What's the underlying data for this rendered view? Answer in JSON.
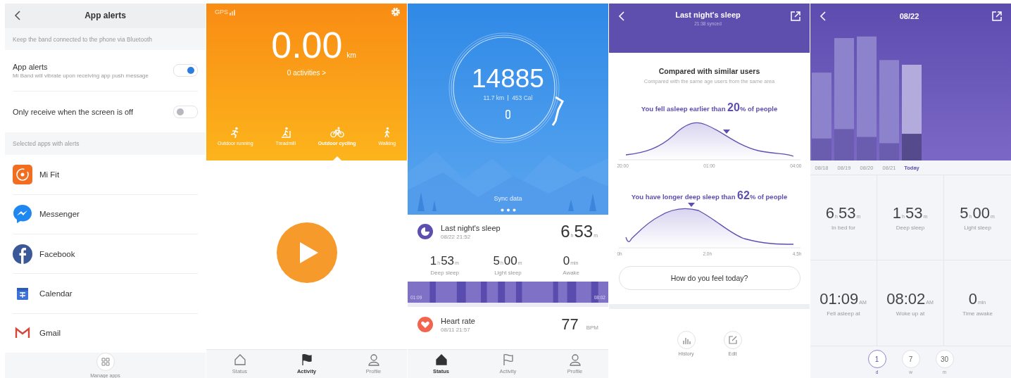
{
  "app_alerts": {
    "title": "App alerts",
    "note": "Keep the band connected to the phone via Bluetooth",
    "toggles": [
      {
        "label": "App alerts",
        "description": "Mi Band will vibrate upon receiving app push message",
        "on": true
      },
      {
        "label": "Only receive when the screen is off",
        "on": false
      }
    ],
    "section": "Selected apps with alerts",
    "apps": [
      {
        "name": "Mi Fit",
        "kind": "mifit"
      },
      {
        "name": "Messenger",
        "kind": "messenger"
      },
      {
        "name": "Facebook",
        "kind": "facebook"
      },
      {
        "name": "Calendar",
        "kind": "calendar"
      },
      {
        "name": "Gmail",
        "kind": "gmail"
      }
    ],
    "manage": "Manage apps"
  },
  "activity": {
    "gps": "GPS",
    "distance": "0.00",
    "unit": "km",
    "activities": "0 activities >",
    "types": [
      {
        "label": "Outdoor running",
        "kind": "run",
        "selected": false
      },
      {
        "label": "Treadmill",
        "kind": "treadmill",
        "selected": false
      },
      {
        "label": "Outdoor cycling",
        "kind": "cycle",
        "selected": true
      },
      {
        "label": "Walking",
        "kind": "walk",
        "selected": false
      }
    ],
    "tabs": [
      {
        "label": "Status",
        "kind": "home",
        "selected": false
      },
      {
        "label": "Activity",
        "kind": "flag",
        "selected": true
      },
      {
        "label": "Profile",
        "kind": "person",
        "selected": false
      }
    ]
  },
  "status": {
    "steps": "14885",
    "distance": "11.7 km",
    "calories": "453 Cal",
    "sync": "Sync data",
    "sleep": {
      "title": "Last night's sleep",
      "time": "08/22 21:52",
      "value": [
        {
          "text": "6",
          "kind": "num"
        },
        {
          "text": "h",
          "kind": "unit"
        },
        {
          "text": "53",
          "kind": "num"
        },
        {
          "text": "m",
          "kind": "unit"
        }
      ]
    },
    "metrics": [
      {
        "label": "Deep sleep",
        "value": [
          {
            "text": "1",
            "kind": "num"
          },
          {
            "text": "h",
            "kind": "unit"
          },
          {
            "text": "53",
            "kind": "num"
          },
          {
            "text": "m",
            "kind": "unit"
          }
        ]
      },
      {
        "label": "Light sleep",
        "value": [
          {
            "text": "5",
            "kind": "num"
          },
          {
            "text": "h",
            "kind": "unit"
          },
          {
            "text": "00",
            "kind": "num"
          },
          {
            "text": "m",
            "kind": "unit"
          }
        ]
      },
      {
        "label": "Awake",
        "value": [
          {
            "text": "0",
            "kind": "num"
          },
          {
            "text": "min",
            "kind": "unit"
          }
        ]
      }
    ],
    "timeline": {
      "start": "01:09",
      "end": "08:02"
    },
    "heart": {
      "title": "Heart rate",
      "time": "08/11 21:57",
      "value": "77",
      "unit": "BPM"
    },
    "tabs": [
      {
        "label": "Status",
        "kind": "home",
        "selected": true
      },
      {
        "label": "Activity",
        "kind": "flag",
        "selected": false
      },
      {
        "label": "Profile",
        "kind": "person",
        "selected": false
      }
    ]
  },
  "sleep_detail": {
    "title": "Last night's sleep",
    "synced": "21:38 synced",
    "heading": "Compared with similar users",
    "subheading": "Compared with the same age users from the same area",
    "comparisons": [
      {
        "text": "You fell asleep earlier than **20**% of people",
        "axis": [
          "20:00",
          "01:00",
          "04:00"
        ],
        "kind": "bedtime"
      },
      {
        "text": "You have longer deep sleep than **62**% of people",
        "axis": [
          "0h",
          "2.0h",
          "4.5h"
        ],
        "kind": "deep"
      }
    ],
    "feel": "How do you feel today?",
    "actions": [
      {
        "label": "History",
        "kind": "chart"
      },
      {
        "label": "Edit",
        "kind": "edit"
      }
    ]
  },
  "day_view": {
    "title": "08/22",
    "days": [
      {
        "label": "08/18",
        "selected": false
      },
      {
        "label": "08/19",
        "selected": false
      },
      {
        "label": "08/20",
        "selected": false
      },
      {
        "label": "08/21",
        "selected": false
      },
      {
        "label": "Today",
        "selected": true
      }
    ],
    "stats": [
      {
        "label": "In bed for",
        "value": [
          {
            "text": "6",
            "kind": "num"
          },
          {
            "text": "h",
            "kind": "unit"
          },
          {
            "text": "53",
            "kind": "num"
          },
          {
            "text": "m",
            "kind": "unit"
          }
        ]
      },
      {
        "label": "Deep sleep",
        "value": [
          {
            "text": "1",
            "kind": "num"
          },
          {
            "text": "h",
            "kind": "unit"
          },
          {
            "text": "53",
            "kind": "num"
          },
          {
            "text": "m",
            "kind": "unit"
          }
        ]
      },
      {
        "label": "Light sleep",
        "value": [
          {
            "text": "5",
            "kind": "num"
          },
          {
            "text": "h",
            "kind": "unit"
          },
          {
            "text": "00",
            "kind": "num"
          },
          {
            "text": "m",
            "kind": "unit"
          }
        ]
      },
      {
        "label": "Fell asleep at",
        "value": [
          {
            "text": "01:09",
            "kind": "num"
          },
          {
            "text": "AM",
            "kind": "unit"
          }
        ]
      },
      {
        "label": "Woke up at",
        "value": [
          {
            "text": "08:02",
            "kind": "num"
          },
          {
            "text": "AM",
            "kind": "unit"
          }
        ]
      },
      {
        "label": "Time awake",
        "value": [
          {
            "text": "0",
            "kind": "num"
          },
          {
            "text": "min",
            "kind": "unit"
          }
        ]
      }
    ],
    "ranges": [
      {
        "label": "1",
        "unit": "d",
        "selected": true
      },
      {
        "label": "7",
        "unit": "w",
        "selected": false
      },
      {
        "label": "30",
        "unit": "m",
        "selected": false
      }
    ]
  }
}
